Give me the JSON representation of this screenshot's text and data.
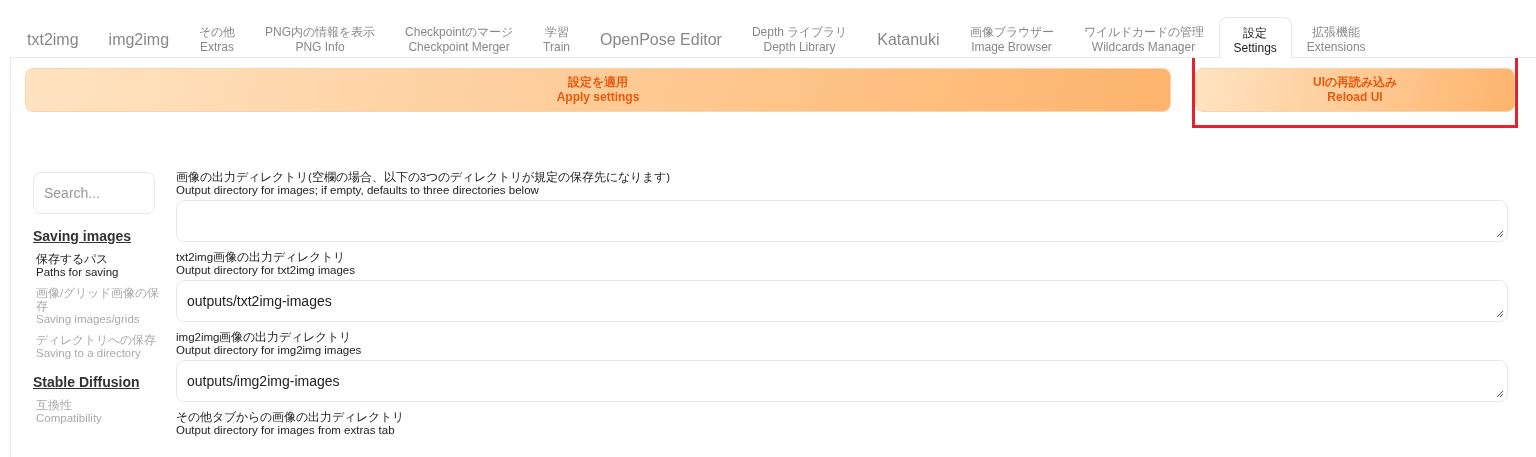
{
  "tabs": [
    {
      "label": "txt2img",
      "selected": false
    },
    {
      "label": "img2img",
      "selected": false
    },
    {
      "label": "その他",
      "sublabel": "Extras",
      "selected": false
    },
    {
      "label": "PNG内の情報を表示",
      "sublabel": "PNG Info",
      "selected": false
    },
    {
      "label": "Checkpointのマージ",
      "sublabel": "Checkpoint Merger",
      "selected": false
    },
    {
      "label": "学習",
      "sublabel": "Train",
      "selected": false
    },
    {
      "label": "OpenPose Editor",
      "selected": false
    },
    {
      "label": "Depth ライブラリ",
      "sublabel": "Depth Library",
      "selected": false
    },
    {
      "label": "Katanuki",
      "selected": false
    },
    {
      "label": "画像ブラウザー",
      "sublabel": "Image Browser",
      "selected": false
    },
    {
      "label": "ワイルドカードの管理",
      "sublabel": "Wildcards Manager",
      "selected": false
    },
    {
      "label": "設定",
      "sublabel": "Settings",
      "selected": true
    },
    {
      "label": "拡張機能",
      "sublabel": "Extensions",
      "selected": false
    }
  ],
  "buttons": [
    {
      "label": "設定を適用",
      "sublabel": "Apply settings",
      "highlighted": false
    },
    {
      "label": "UIの再読み込み",
      "sublabel": "Reload UI",
      "highlighted": true
    }
  ],
  "search": {
    "placeholder": "Search..."
  },
  "sidebar": [
    {
      "title": "Saving images",
      "children": [
        {
          "label": "保存するパス",
          "sublabel": "Paths for saving",
          "selected": true
        },
        {
          "label": "画像/グリッド画像の保存",
          "sublabel": "Saving images/grids",
          "selected": false
        },
        {
          "label": "ディレクトリへの保存",
          "sublabel": "Saving to a directory",
          "selected": false
        }
      ]
    },
    {
      "title": "Stable Diffusion",
      "children": [
        {
          "label": "互換性",
          "sublabel": "Compatibility",
          "selected": false
        }
      ]
    }
  ],
  "settings": [
    {
      "label": "画像の出力ディレクトリ(空欄の場合、以下の3つのディレクトリが規定の保存先になります)",
      "sublabel": "Output directory for images; if empty, defaults to three directories below",
      "kind": "field"
    },
    {
      "label": "txt2img画像の出力ディレクトリ",
      "sublabel": "Output directory for txt2img images",
      "kind": "field",
      "value": "outputs/txt2img-images"
    },
    {
      "label": "img2img画像の出力ディレクトリ",
      "sublabel": "Output directory for img2img images",
      "kind": "field",
      "value": "outputs/img2img-images"
    },
    {
      "label": "その他タブからの画像の出力ディレクトリ",
      "sublabel": "Output directory for images from extras tab",
      "kind": "label"
    }
  ]
}
